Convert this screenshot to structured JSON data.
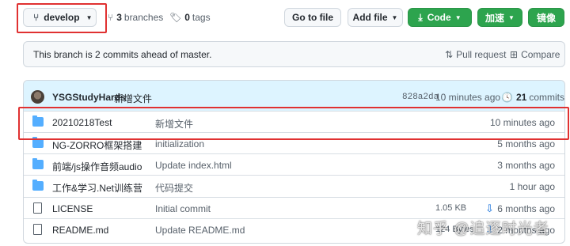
{
  "toolbar": {
    "branch": "develop",
    "branches_count": "3",
    "branches_label": "branches",
    "tags_count": "0",
    "tags_label": "tags",
    "goto_file": "Go to file",
    "add_file": "Add file",
    "code": "Code",
    "accelerate": "加速",
    "mirror": "镜像"
  },
  "ahead_bar": {
    "text": "This branch is 2 commits ahead of master.",
    "pull_request": "Pull request",
    "compare": "Compare"
  },
  "latest_commit": {
    "author": "YSGStudyHards",
    "message": "新增文件",
    "sha": "828a2da",
    "time": "10 minutes ago",
    "count": "21",
    "count_label": "commits"
  },
  "files": [
    {
      "type": "folder",
      "name": "20210218Test",
      "message": "新增文件",
      "size": "",
      "time": "10 minutes ago"
    },
    {
      "type": "folder",
      "name": "NG-ZORRO框架搭建",
      "message": "initialization",
      "size": "",
      "time": "5 months ago"
    },
    {
      "type": "folder",
      "name": "前端/js操作音频audio",
      "message": "Update index.html",
      "size": "",
      "time": "3 months ago"
    },
    {
      "type": "folder",
      "name": "工作&学习.Net训练营",
      "message": "代码提交",
      "size": "",
      "time": "1 hour ago"
    },
    {
      "type": "file",
      "name": "LICENSE",
      "message": "Initial commit",
      "size": "1.05 KB",
      "time": "6 months ago"
    },
    {
      "type": "file",
      "name": "README.md",
      "message": "Update README.md",
      "size": "124 Bytes",
      "time": "2 months ago"
    }
  ],
  "watermark": "知乎 @追逐时光者",
  "colors": {
    "accent_green": "#2da44e",
    "highlight_red": "#e03131",
    "folder_blue": "#54aeff",
    "commit_bar": "#ddf4ff"
  },
  "icons": [
    "branch-icon",
    "tag-icon",
    "download-icon",
    "pull-request-icon",
    "compare-icon",
    "history-icon",
    "folder-icon",
    "file-icon",
    "cloud-download-icon"
  ]
}
